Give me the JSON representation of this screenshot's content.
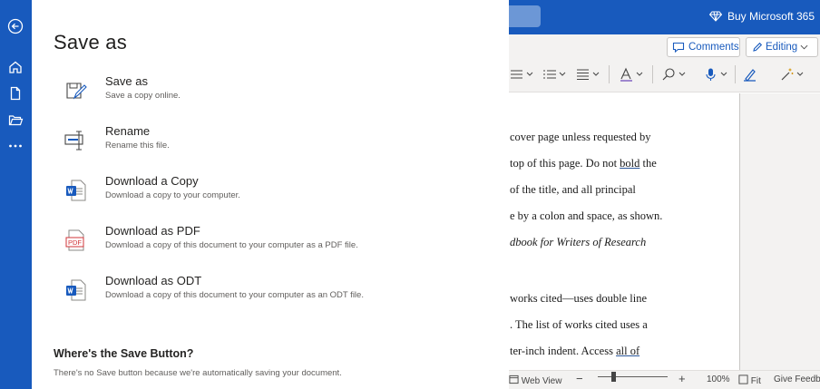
{
  "rail": {
    "items": [
      "back-arrow-icon",
      "home-icon",
      "new-document-icon",
      "open-folder-icon",
      "more-icon"
    ]
  },
  "backstage": {
    "title": "Save as",
    "options": [
      {
        "label": "Save as",
        "description": "Save a copy online.",
        "icon": "save-as-icon"
      },
      {
        "label": "Rename",
        "description": "Rename this file.",
        "icon": "rename-icon"
      },
      {
        "label": "Download a Copy",
        "description": "Download a copy to your computer.",
        "icon": "word-document-icon"
      },
      {
        "label": "Download as PDF",
        "description": "Download a copy of this document to your computer as a PDF file.",
        "icon": "pdf-icon",
        "icon_text": "PDF"
      },
      {
        "label": "Download as ODT",
        "description": "Download a copy of this document to your computer as an ODT file.",
        "icon": "odt-icon"
      }
    ],
    "where_title": "Where's the Save Button?",
    "where_desc": "There's no Save button because we're automatically saving your document."
  },
  "topbar": {
    "buy_label": "Buy Microsoft 365",
    "brand_color": "#185abd"
  },
  "ribbon": {
    "comments_label": "Comments",
    "editing_label": "Editing",
    "tools": [
      "bullets-icon",
      "numbering-icon",
      "align-icon",
      "styles-icon",
      "find-icon",
      "dictate-icon",
      "editor-icon",
      "designer-icon"
    ]
  },
  "document": {
    "lines": [
      {
        "text": "cover page unless requested by"
      },
      {
        "text": "top of this page.  Do not ",
        "underlined": "bold",
        "after": " the"
      },
      {
        "text": "of the title, and all principal"
      },
      {
        "text": "e by a colon and space, as shown."
      },
      {
        "text": "dbook for Writers of Research",
        "italic": true
      },
      {
        "text": "works cited—uses double line"
      },
      {
        "text": ". The list of works cited uses a"
      },
      {
        "text": "ter-inch indent. Access ",
        "underlined": "all of",
        "after": ""
      }
    ]
  },
  "statusbar": {
    "web_view": "Web View",
    "minus": "−",
    "plus": "+",
    "zoom": "100%",
    "fit": "Fit",
    "feedback": "Give Feedb"
  }
}
